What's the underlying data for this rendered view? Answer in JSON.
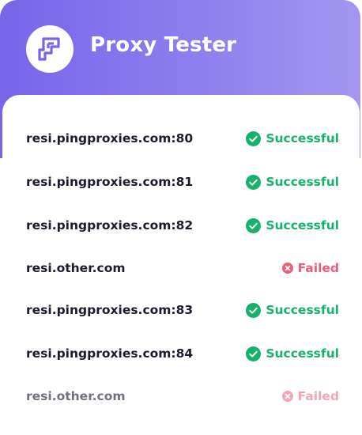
{
  "app": {
    "title": "Proxy Tester",
    "logo_icon": "proxy-logo-icon",
    "colors": {
      "header_gradient_start": "#7765ea",
      "header_gradient_end": "#a397f0",
      "success": "#17b26a",
      "failure": "#ec5d78",
      "host_text": "#1c1b2e"
    }
  },
  "results": [
    {
      "host": "resi.pingproxies.com:80",
      "status": "Successful",
      "state": "success",
      "icon": "check-circle-icon"
    },
    {
      "host": "resi.pingproxies.com:81",
      "status": "Successful",
      "state": "success",
      "icon": "check-circle-icon"
    },
    {
      "host": "resi.pingproxies.com:82",
      "status": "Successful",
      "state": "success",
      "icon": "check-circle-icon"
    },
    {
      "host": "resi.other.com",
      "status": "Failed",
      "state": "failed",
      "icon": "x-circle-icon"
    },
    {
      "host": "resi.pingproxies.com:83",
      "status": "Successful",
      "state": "success",
      "icon": "check-circle-icon"
    },
    {
      "host": "resi.pingproxies.com:84",
      "status": "Successful",
      "state": "success",
      "icon": "check-circle-icon"
    },
    {
      "host": "resi.other.com",
      "status": "Failed",
      "state": "failed",
      "icon": "x-circle-icon"
    }
  ]
}
